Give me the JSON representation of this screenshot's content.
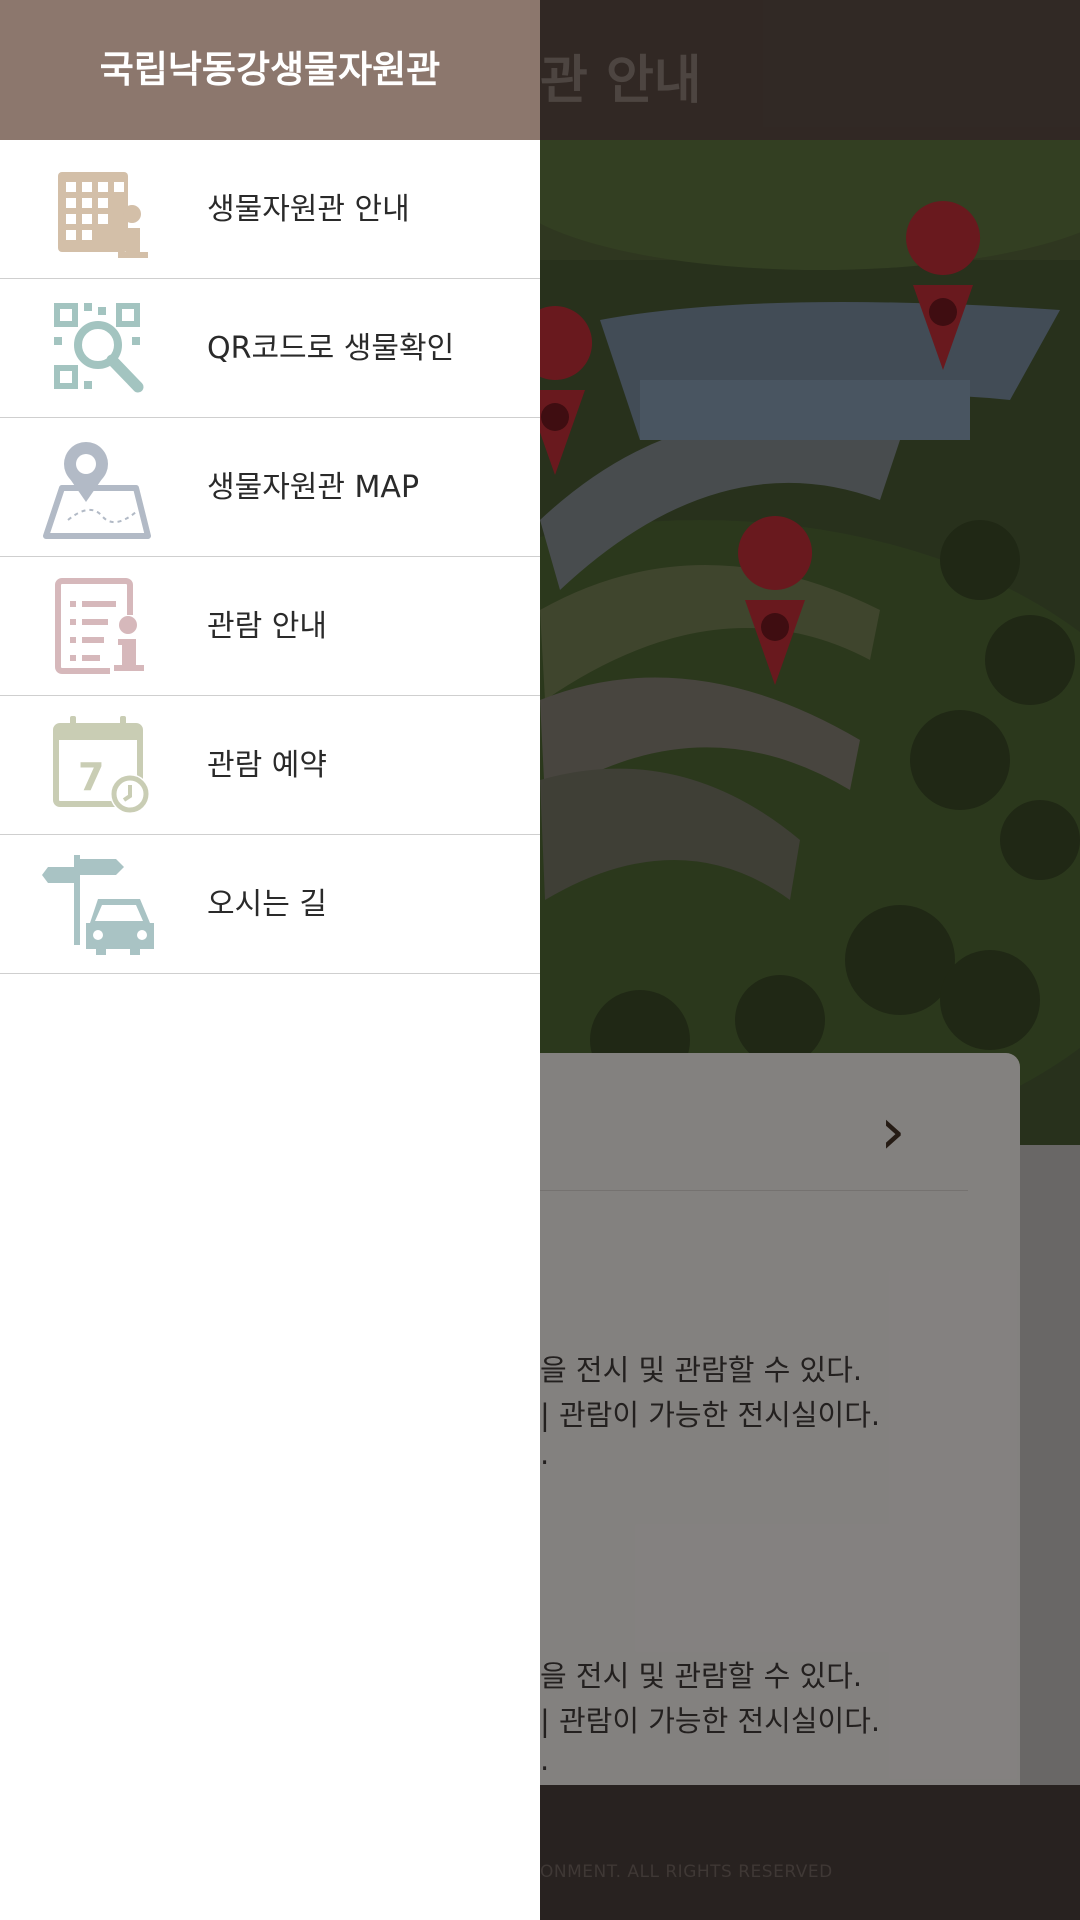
{
  "drawer": {
    "title": "국립낙동강생물자원관",
    "items": [
      {
        "label": "생물자원관 안내",
        "icon": "building-info-icon"
      },
      {
        "label": "QR코드로 생물확인",
        "icon": "qr-search-icon"
      },
      {
        "label": "생물자원관 MAP",
        "icon": "map-pin-icon"
      },
      {
        "label": "관람 안내",
        "icon": "document-info-icon"
      },
      {
        "label": "관람 예약",
        "icon": "calendar-icon"
      },
      {
        "label": "오시는 길",
        "icon": "signpost-car-icon"
      }
    ]
  },
  "background": {
    "title": "관 안내",
    "text_lines": [
      "을 전시 및  관람할 수 있다.",
      "| 관람이 가능한 전시실이다.",
      ".",
      "을 전시 및  관람할 수 있다.",
      "| 관람이 가능한 전시실이다.",
      "."
    ],
    "footer": "ONMENT. ALL RIGHTS RESERVED"
  },
  "colors": {
    "drawer_header": "#8c776d",
    "building_icon": "#d3bfa8",
    "qr_icon": "#a3c4c0",
    "map_icon": "#b2bac6",
    "doc_icon": "#d6b8bb",
    "calendar_icon": "#c9cdb4",
    "car_icon": "#a9c3c4"
  }
}
